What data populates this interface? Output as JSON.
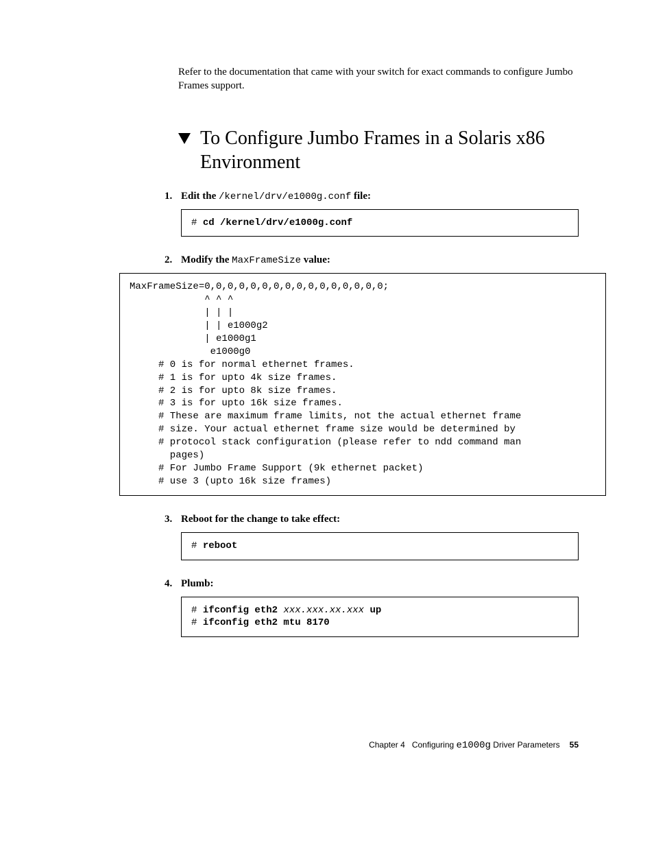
{
  "intro": "Refer to the documentation that came with your switch for exact commands to configure Jumbo Frames support.",
  "heading": "To Configure Jumbo Frames in a Solaris x86 Environment",
  "steps": {
    "s1": {
      "pre": "Edit the ",
      "path": "/kernel/drv/e1000g.conf",
      "post": " file:",
      "code_prefix": "# ",
      "code_cmd": "cd /kernel/drv/e1000g.conf"
    },
    "s2": {
      "pre": "Modify the ",
      "var": "MaxFrameSize",
      "post": " value:",
      "code": "MaxFrameSize=0,0,0,0,0,0,0,0,0,0,0,0,0,0,0,0;\n             ^ ^ ^\n             | | |\n             | | e1000g2\n             | e1000g1\n              e1000g0\n     # 0 is for normal ethernet frames.\n     # 1 is for upto 4k size frames.\n     # 2 is for upto 8k size frames.\n     # 3 is for upto 16k size frames.\n     # These are maximum frame limits, not the actual ethernet frame\n     # size. Your actual ethernet frame size would be determined by\n     # protocol stack configuration (please refer to ndd command man\n       pages)\n     # For Jumbo Frame Support (9k ethernet packet)\n     # use 3 (upto 16k size frames)"
    },
    "s3": {
      "text": "Reboot for the change to take effect:",
      "code_prefix": "# ",
      "code_cmd": "reboot"
    },
    "s4": {
      "text": "Plumb:",
      "line1_prefix": "# ",
      "line1_cmd1": "ifconfig eth2 ",
      "line1_arg": "xxx.xxx.xx.xxx",
      "line1_cmd2": " up",
      "line2_prefix": "# ",
      "line2_cmd": "ifconfig eth2 mtu 8170"
    }
  },
  "footer": {
    "chapter_label": "Chapter 4",
    "title_pre": "Configuring ",
    "title_code": "e1000g",
    "title_post": " Driver Parameters",
    "page": "55"
  }
}
